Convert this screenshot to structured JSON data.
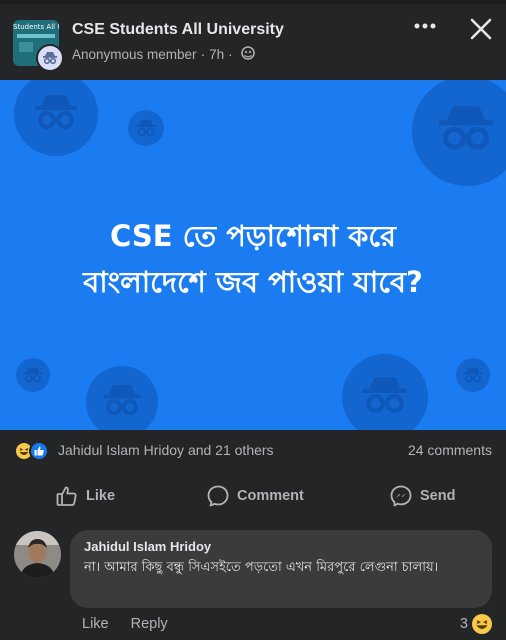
{
  "header": {
    "group_name": "CSE Students All University",
    "group_avatar_text": "Students All Univ",
    "author": "Anonymous member",
    "separator": "·",
    "time": "7h",
    "privacy_icon": "group-privacy-icon"
  },
  "banner": {
    "line1": "CSE তে পড়াশোনা করে",
    "line2": "বাংলাদেশে জব পাওয়া যাবে?",
    "background": "#1a7cf0"
  },
  "reactions": {
    "icons": [
      "haha-icon",
      "like-icon"
    ],
    "summary": "Jahidul Islam Hridoy and 21 others",
    "comments": "24 comments"
  },
  "actions": {
    "like": "Like",
    "comment": "Comment",
    "send": "Send"
  },
  "comment": {
    "author": "Jahidul Islam Hridoy",
    "text": "না। আমার কিছু বন্ধু সিএসইতে পড়তো এখন মিরপুরে লেগুনা চালায়।",
    "like_label": "Like",
    "reply_label": "Reply",
    "reaction_count": "3",
    "reaction_icon": "haha-icon"
  },
  "colors": {
    "background": "#242526",
    "bubble": "#3a3b3c",
    "muted_text": "#b0b3b8",
    "primary_text": "#e4e6eb"
  }
}
